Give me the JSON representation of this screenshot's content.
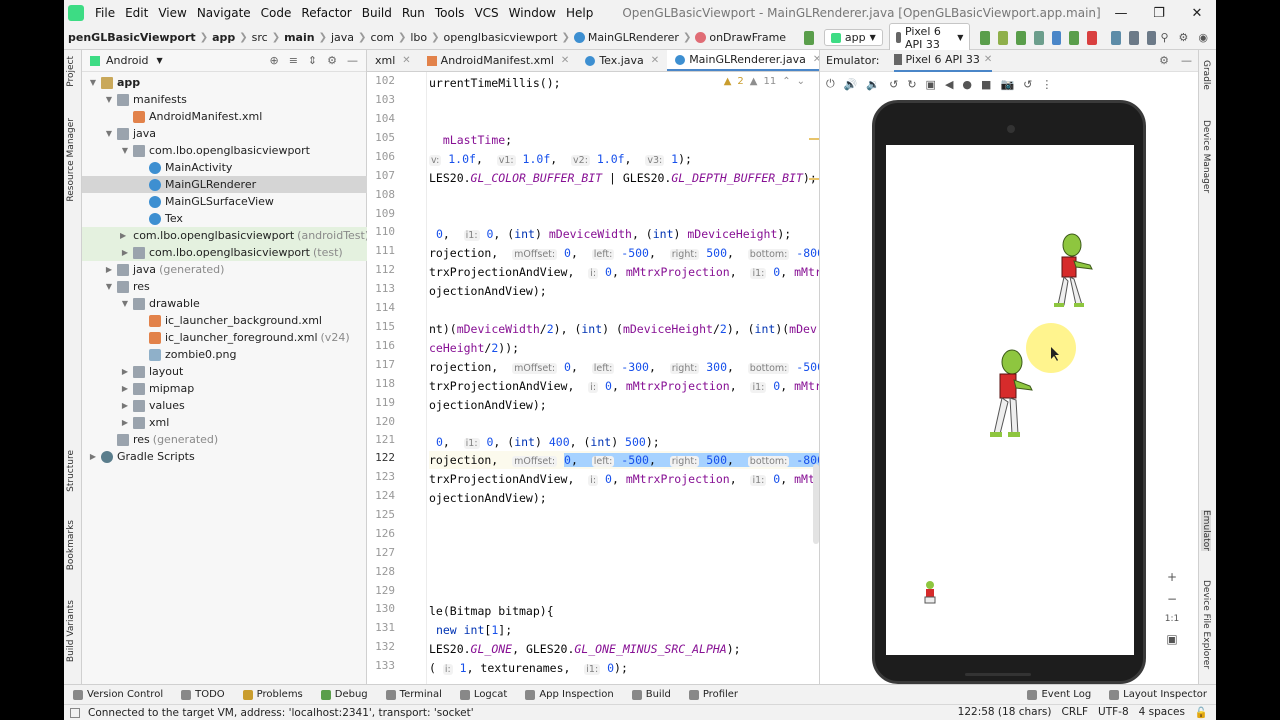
{
  "menu": {
    "items": [
      "File",
      "Edit",
      "View",
      "Navigate",
      "Code",
      "Refactor",
      "Build",
      "Run",
      "Tools",
      "VCS",
      "Window",
      "Help"
    ],
    "window_title": "OpenGLBasicViewport - MainGLRenderer.java [OpenGLBasicViewport.app.main]"
  },
  "nav": {
    "crumbs": [
      "penGLBasicViewport",
      "app",
      "src",
      "main",
      "java",
      "com",
      "lbo",
      "openglbasicviewport"
    ],
    "class": "MainGLRenderer",
    "method": "onDrawFrame",
    "run_config": "app",
    "device": "Pixel 6 API 33"
  },
  "left_tabs": [
    "Project",
    "Resource Manager",
    "Structure",
    "Bookmarks",
    "Build Variants"
  ],
  "project": {
    "view": "Android",
    "tree": [
      {
        "label": "app",
        "hint": ""
      },
      {
        "label": "manifests",
        "hint": ""
      },
      {
        "label": "AndroidManifest.xml",
        "hint": ""
      },
      {
        "label": "java",
        "hint": ""
      },
      {
        "label": "com.lbo.openglbasicviewport",
        "hint": ""
      },
      {
        "label": "MainActivity",
        "hint": ""
      },
      {
        "label": "MainGLRenderer",
        "hint": ""
      },
      {
        "label": "MainGLSurfaceView",
        "hint": ""
      },
      {
        "label": "Tex",
        "hint": ""
      },
      {
        "label": "com.lbo.openglbasicviewport",
        "hint": "(androidTest)"
      },
      {
        "label": "com.lbo.openglbasicviewport",
        "hint": "(test)"
      },
      {
        "label": "java",
        "hint": "(generated)"
      },
      {
        "label": "res",
        "hint": ""
      },
      {
        "label": "drawable",
        "hint": ""
      },
      {
        "label": "ic_launcher_background.xml",
        "hint": ""
      },
      {
        "label": "ic_launcher_foreground.xml",
        "hint": "(v24)"
      },
      {
        "label": "zombie0.png",
        "hint": ""
      },
      {
        "label": "layout",
        "hint": ""
      },
      {
        "label": "mipmap",
        "hint": ""
      },
      {
        "label": "values",
        "hint": ""
      },
      {
        "label": "xml",
        "hint": ""
      },
      {
        "label": "res",
        "hint": "(generated)"
      },
      {
        "label": "Gradle Scripts",
        "hint": ""
      }
    ]
  },
  "editor_tabs": [
    "xml",
    "AndroidManifest.xml",
    "Tex.java",
    "MainGLRenderer.java"
  ],
  "inspections": {
    "warnings": "2",
    "weak": "11"
  },
  "gutter_lines": [
    "102",
    "103",
    "104",
    "105",
    "106",
    "107",
    "108",
    "109",
    "110",
    "111",
    "112",
    "113",
    "114",
    "115",
    "116",
    "117",
    "118",
    "119",
    "120",
    "121",
    "122",
    "123",
    "124",
    "125",
    "126",
    "127",
    "128",
    "129",
    "130",
    "131",
    "132",
    "133"
  ],
  "current_line": "122",
  "emulator": {
    "label": "Emulator:",
    "device_tab": "Pixel 6 API 33"
  },
  "right_tabs": [
    "Gradle",
    "Device Manager",
    "Emulator",
    "Device File Explorer"
  ],
  "bottom_tools": [
    "Version Control",
    "TODO",
    "Problems",
    "Debug",
    "Terminal",
    "Logcat",
    "App Inspection",
    "Build",
    "Profiler"
  ],
  "bottom_tools_right": [
    "Event Log",
    "Layout Inspector"
  ],
  "status": {
    "message": "Connected to the target VM, address: 'localhost:2341', transport: 'socket'",
    "position": "122:58 (18 chars)",
    "line_sep": "CRLF",
    "encoding": "UTF-8",
    "indent": "4 spaces"
  },
  "colors": {
    "accent": "#4a86c8",
    "selection": "#a6d2ff",
    "android_green": "#3ddc84"
  }
}
